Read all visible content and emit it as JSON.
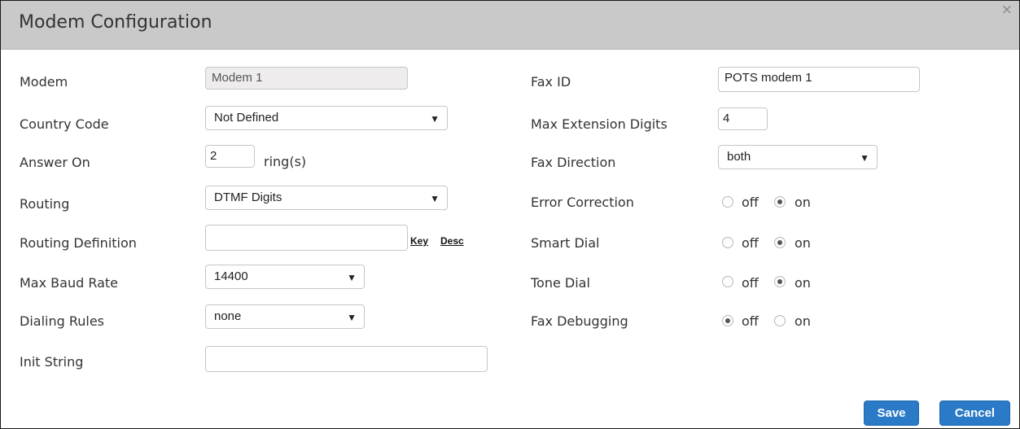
{
  "dialog": {
    "title": "Modem Configuration",
    "close_glyph": "×"
  },
  "left": {
    "modem": {
      "label": "Modem",
      "value": "Modem 1"
    },
    "country_code": {
      "label": "Country Code",
      "value": "Not Defined"
    },
    "answer_on": {
      "label": "Answer On",
      "value": "2",
      "unit": "ring(s)"
    },
    "routing": {
      "label": "Routing",
      "value": "DTMF Digits"
    },
    "routing_definition": {
      "label": "Routing Definition",
      "value": "",
      "key_link": "Key",
      "desc_link": "Desc"
    },
    "max_baud_rate": {
      "label": "Max Baud Rate",
      "value": "14400"
    },
    "dialing_rules": {
      "label": "Dialing Rules",
      "value": "none"
    },
    "init_string": {
      "label": "Init String",
      "value": ""
    }
  },
  "right": {
    "fax_id": {
      "label": "Fax ID",
      "value": "POTS modem 1"
    },
    "max_extension_digits": {
      "label": "Max Extension Digits",
      "value": "4"
    },
    "fax_direction": {
      "label": "Fax Direction",
      "value": "both"
    },
    "error_correction": {
      "label": "Error Correction",
      "off": "off",
      "on": "on",
      "selected": "on"
    },
    "smart_dial": {
      "label": "Smart Dial",
      "off": "off",
      "on": "on",
      "selected": "on"
    },
    "tone_dial": {
      "label": "Tone Dial",
      "off": "off",
      "on": "on",
      "selected": "on"
    },
    "fax_debugging": {
      "label": "Fax Debugging",
      "off": "off",
      "on": "on",
      "selected": "off"
    }
  },
  "buttons": {
    "save": "Save",
    "cancel": "Cancel"
  },
  "colors": {
    "titlebar": "#c9c9c9",
    "button": "#2a7ac8"
  },
  "icons": {
    "dropdown": "▼"
  }
}
